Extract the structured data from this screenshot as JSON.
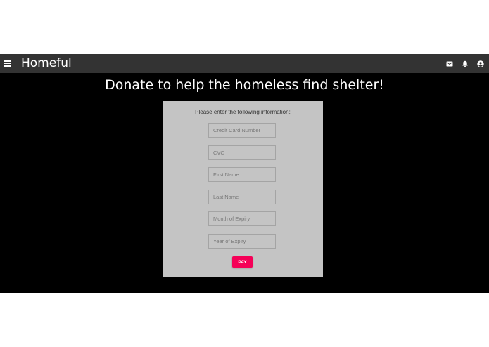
{
  "app": {
    "title": "Homeful"
  },
  "appbar": {
    "menu_icon": "hamburger-menu-icon",
    "actions": [
      "mail-icon",
      "bell-icon",
      "account-circle-icon"
    ]
  },
  "page": {
    "headline": "Donate to help the homeless find shelter!"
  },
  "form": {
    "prompt": "Please enter the following information:",
    "fields": {
      "card_number": {
        "placeholder": "Credit Card Number",
        "value": ""
      },
      "cvc": {
        "placeholder": "CVC",
        "value": ""
      },
      "first_name": {
        "placeholder": "First Name",
        "value": ""
      },
      "last_name": {
        "placeholder": "Last Name",
        "value": ""
      },
      "expiry_month": {
        "placeholder": "Month of Expiry",
        "value": ""
      },
      "expiry_year": {
        "placeholder": "Year of Expiry",
        "value": ""
      }
    },
    "pay_label": "PAY"
  },
  "colors": {
    "appbar": "#333333",
    "content_background": "#000000",
    "card": "#c4c4c4",
    "accent": "#f50057"
  }
}
